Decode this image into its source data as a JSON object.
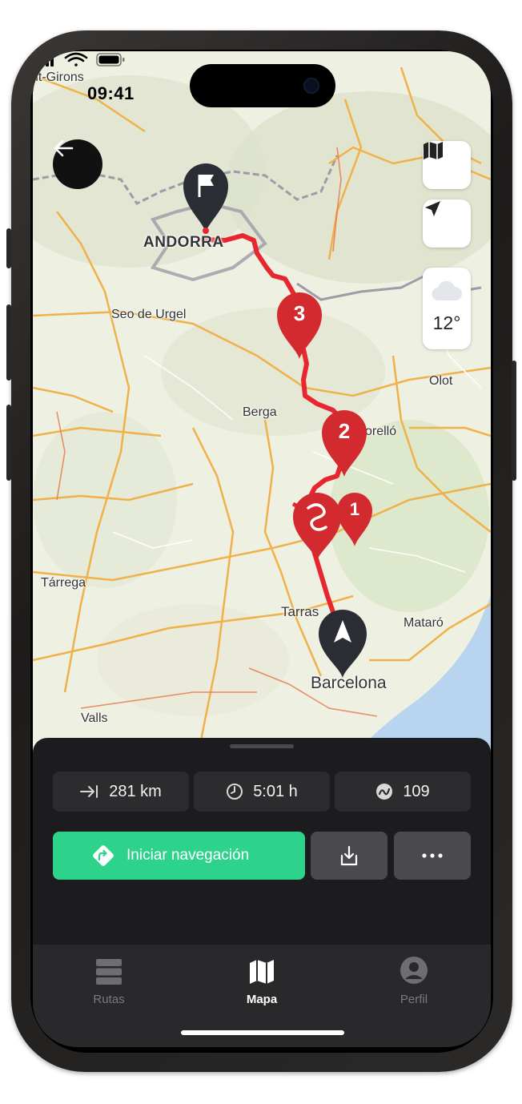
{
  "status_bar": {
    "time": "09:41"
  },
  "map": {
    "labels": {
      "saint_girons": "nt-Girons",
      "andorra": "ANDORRA",
      "seo_de_urgel": "Seo de Urgel",
      "olot": "Olot",
      "berga": "Berga",
      "torello": "orelló",
      "tarrega": "Tárrega",
      "tarrasa": "Tarras",
      "mataro": "Mataró",
      "barcelona": "Barcelona",
      "valls": "Valls"
    },
    "markers": {
      "stop_3": "3",
      "stop_2": "2",
      "stop_1": "1"
    },
    "weather": {
      "icon": "cloud-icon",
      "temperature": "12°"
    },
    "colors": {
      "route": "#e8262f",
      "marker": "#d32a2f",
      "water": "#b9d4ee",
      "land": "#eef0e2"
    }
  },
  "stats": {
    "distance": "281 km",
    "duration": "5:01 h",
    "curviness": "109"
  },
  "actions": {
    "start_navigation": "Iniciar navegación",
    "accent": "#2dd38b"
  },
  "tabbar": {
    "tabs": [
      {
        "label": "Rutas",
        "active": false
      },
      {
        "label": "Mapa",
        "active": true
      },
      {
        "label": "Perfil",
        "active": false
      }
    ]
  }
}
